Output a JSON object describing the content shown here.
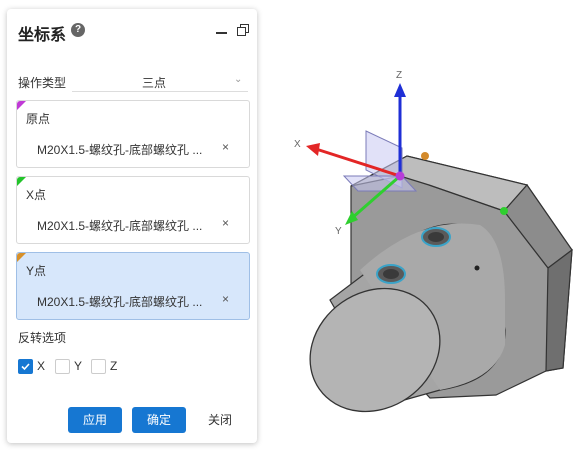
{
  "panel": {
    "title": "坐标系",
    "help_glyph": "?",
    "type_label": "操作类型",
    "type_value": "三点",
    "slots": [
      {
        "label": "原点",
        "value": "M20X1.5-螺纹孔-底部螺纹孔 ...",
        "clear": "×",
        "color": "#c03ad6"
      },
      {
        "label": "X点",
        "value": "M20X1.5-螺纹孔-底部螺纹孔 ...",
        "clear": "×",
        "color": "#22c42a"
      },
      {
        "label": "Y点",
        "value": "M20X1.5-螺纹孔-底部螺纹孔 ...",
        "clear": "×",
        "color": "#d7902a"
      }
    ],
    "reverse_label": "反转选项",
    "reverse_options": [
      {
        "label": "X",
        "checked": true
      },
      {
        "label": "Y",
        "checked": false
      },
      {
        "label": "Z",
        "checked": false
      }
    ],
    "buttons": {
      "apply": "应用",
      "ok": "确定",
      "close": "关闭"
    }
  },
  "viewport": {
    "axes": {
      "z": "Z",
      "x": "X",
      "y": "Y"
    },
    "colors": {
      "x_axis": "#e32626",
      "y_axis": "#2fcf2f",
      "z_axis": "#1f2fd6",
      "origin": "#b73cd8",
      "point_orange": "#d38a2b",
      "point_green": "#2fcf2f"
    }
  }
}
